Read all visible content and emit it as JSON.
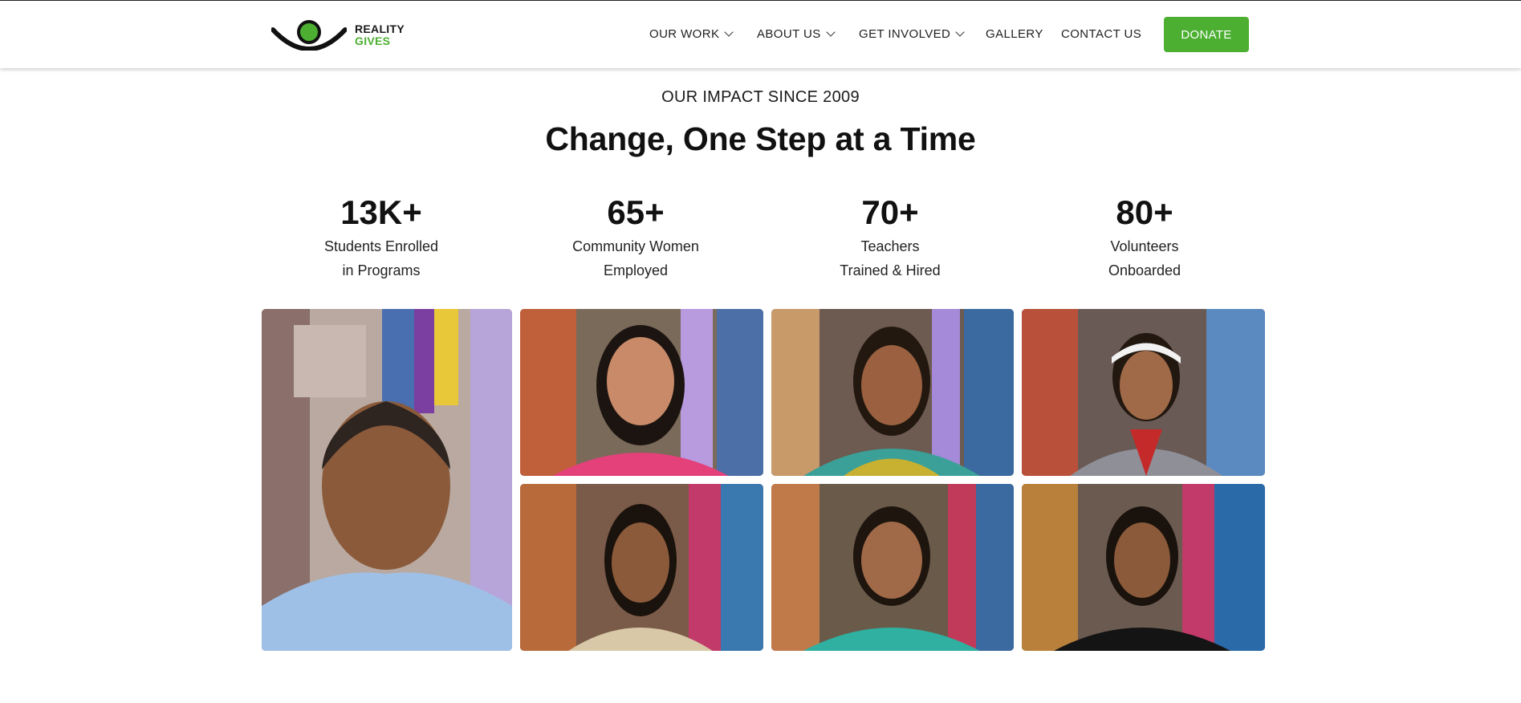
{
  "header": {
    "logo": {
      "line1": "REALITY",
      "line2": "GIVES"
    },
    "nav": [
      {
        "label": "OUR WORK",
        "has_dropdown": true
      },
      {
        "label": "ABOUT US",
        "has_dropdown": true
      },
      {
        "label": "GET INVOLVED",
        "has_dropdown": true
      },
      {
        "label": "GALLERY",
        "has_dropdown": false
      },
      {
        "label": "CONTACT US",
        "has_dropdown": false
      }
    ],
    "donate_label": "DONATE"
  },
  "hero": {
    "eyebrow": "OUR IMPACT SINCE 2009",
    "title": "Change, One Step at a Time"
  },
  "stats": [
    {
      "value": "13K+",
      "label_line1": "Students Enrolled",
      "label_line2": "in Programs"
    },
    {
      "value": "65+",
      "label_line1": "Community Women",
      "label_line2": "Employed"
    },
    {
      "value": "70+",
      "label_line1": "Teachers",
      "label_line2": "Trained & Hired"
    },
    {
      "value": "80+",
      "label_line1": "Volunteers",
      "label_line2": "Onboarded"
    }
  ],
  "gallery": {
    "photos": [
      {
        "subject": "man in light blue shirt"
      },
      {
        "subject": "woman with glasses in pink top"
      },
      {
        "subject": "young woman in colorful scarf"
      },
      {
        "subject": "girl in school uniform with headband"
      },
      {
        "subject": "smiling young woman"
      },
      {
        "subject": "woman in teal saree"
      },
      {
        "subject": "woman in black top"
      }
    ]
  },
  "colors": {
    "brand_green": "#4caf32",
    "text_dark": "#111111",
    "background": "#ffffff"
  },
  "icons": [
    "logo-eye-icon",
    "chevron-down-icon"
  ]
}
